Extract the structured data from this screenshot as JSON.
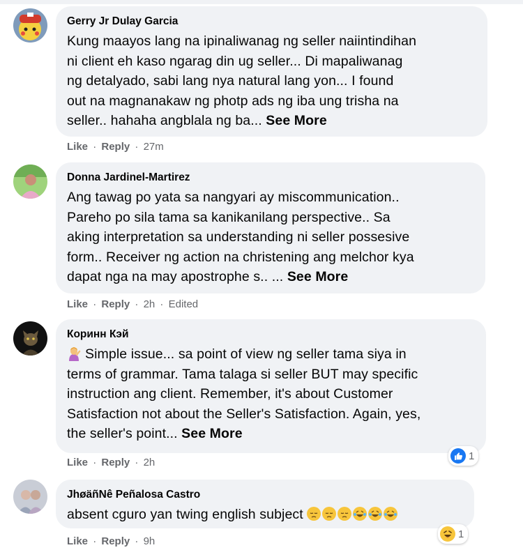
{
  "comments": [
    {
      "author": "Gerry Jr Dulay Garcia",
      "lines": [
        "Kung maayos lang na ipinaliwanag ng seller naiintindihan",
        "ni client eh kaso ngarag din ug seller... Di mapaliwanag",
        "ng detalyado, sabi lang nya natural lang yon... I found",
        "out na magnanakaw ng photp ads ng iba ung trisha na",
        "seller.. hahaha angblala ng ba... "
      ],
      "see_more": "See More",
      "like": "Like",
      "reply": "Reply",
      "time": "27m"
    },
    {
      "author": "Donna Jardinel-Martirez",
      "lines": [
        "Ang tawag po yata sa nangyari ay miscommunication..",
        "Pareho po sila tama sa kanikanilang perspective.. Sa",
        "aking interpretation sa understanding ni seller possesive",
        "form.. Receiver ng action na christening ang melchor kya",
        "dapat nga na may apostrophe s.. ... "
      ],
      "see_more": "See More",
      "like": "Like",
      "reply": "Reply",
      "time": "2h",
      "edited": "Edited"
    },
    {
      "author": "Коринн Кэй",
      "lines": [
        "Simple issue... sa point of view ng seller tama siya in",
        "terms of grammar. Tama talaga si seller BUT may specific",
        "instruction ang client. Remember, it's about Customer",
        "Satisfaction not about the Seller's Satisfaction. Again, yes,",
        "the seller's point... "
      ],
      "see_more": "See More",
      "like": "Like",
      "reply": "Reply",
      "time": "2h",
      "reaction_count": "1",
      "reaction_icon": "like-icon"
    },
    {
      "author": "JhøäñNê Peñalosa Castro",
      "lines": [
        "absent cguro yan twing english subject "
      ],
      "like": "Like",
      "reply": "Reply",
      "time": "9h",
      "reaction_count": "1",
      "reaction_icon": "haha-icon"
    }
  ],
  "separator": "·",
  "colors": {
    "bubble": "#f0f2f5",
    "meta": "#65676b",
    "like_blue": "#1877f2",
    "emoji_yellow": "#f7c53b"
  }
}
